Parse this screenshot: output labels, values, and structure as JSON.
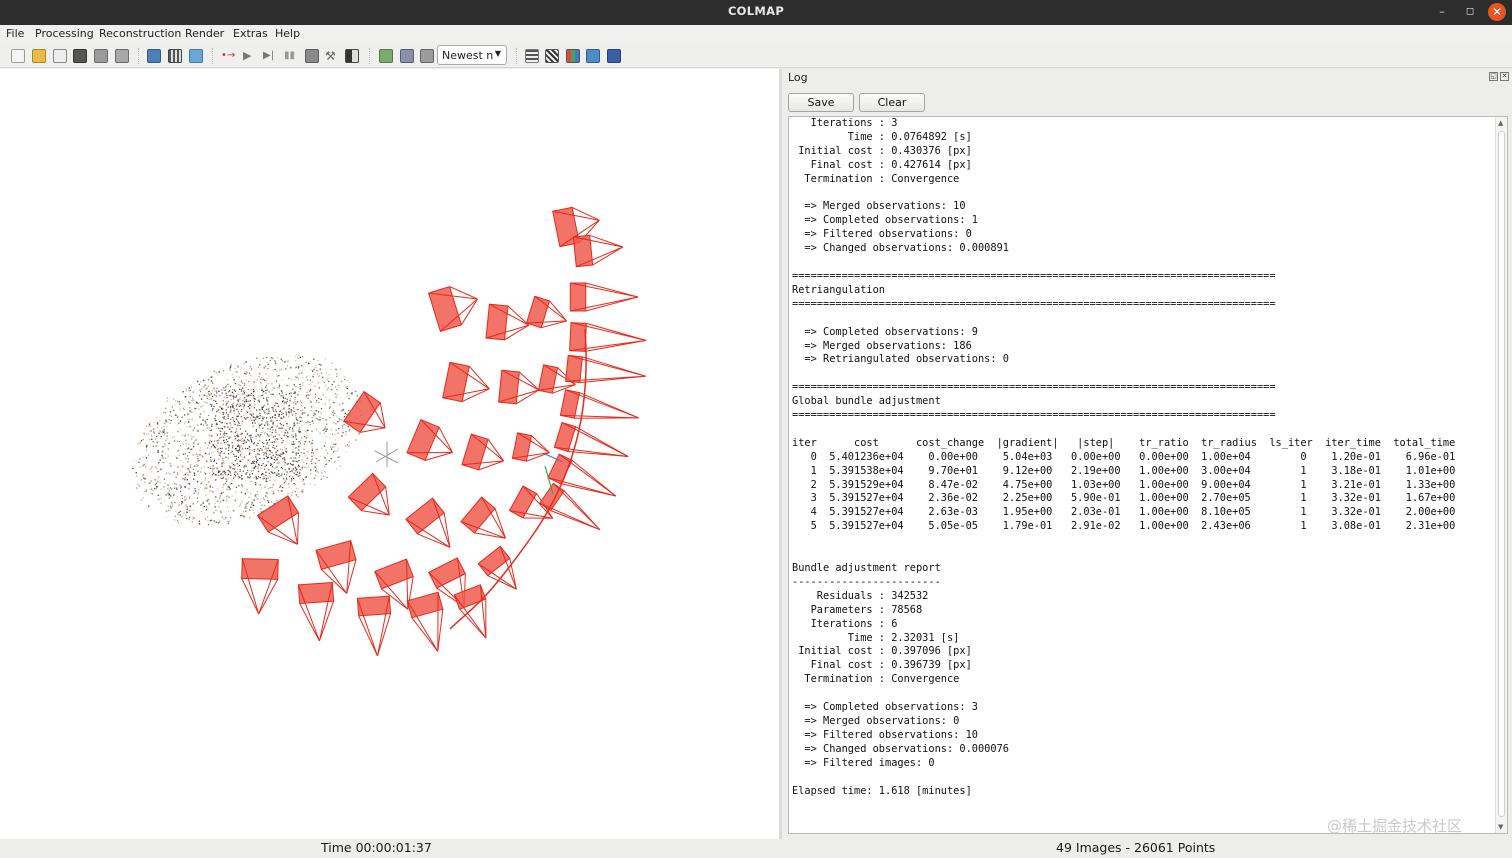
{
  "window": {
    "title": "COLMAP",
    "min_symbol": "–",
    "max_symbol": "◻",
    "close_symbol": "✕"
  },
  "menu": [
    "File",
    "Processing",
    "Reconstruction",
    "Render",
    "Extras",
    "Help"
  ],
  "toolbar": {
    "combo_value": "Newest n",
    "icons": [
      "new-project-icon",
      "open-project-icon",
      "edit-project-icon",
      "save-project-icon",
      "import-icon",
      "export-icon",
      "feature-extraction-icon",
      "feature-matching-icon",
      "database-icon",
      "reconstruction-start-icon",
      "reconstruction-play-icon",
      "reconstruction-step-icon",
      "reconstruction-pause-icon",
      "bundle-adjustment-icon",
      "dense-reconstruction-icon",
      "render-options-icon",
      "grab-image-icon",
      "grab-movie-icon",
      "reset-view-icon",
      "log-icon",
      "match-matrix-icon",
      "model-stats-icon",
      "show-images-icon",
      "show-points-icon"
    ]
  },
  "log": {
    "title": "Log",
    "save_label": "Save",
    "clear_label": "Clear",
    "lines": [
      "   Iterations : 3",
      "         Time : 0.0764892 [s]",
      " Initial cost : 0.430376 [px]",
      "   Final cost : 0.427614 [px]",
      "  Termination : Convergence",
      "",
      "  => Merged observations: 10",
      "  => Completed observations: 1",
      "  => Filtered observations: 0",
      "  => Changed observations: 0.000891",
      "",
      "==============================================================================",
      "Retriangulation",
      "==============================================================================",
      "",
      "  => Completed observations: 9",
      "  => Merged observations: 186",
      "  => Retriangulated observations: 0",
      "",
      "==============================================================================",
      "Global bundle adjustment",
      "==============================================================================",
      "",
      "iter      cost      cost_change  |gradient|   |step|    tr_ratio  tr_radius  ls_iter  iter_time  total_time",
      "   0  5.401236e+04    0.00e+00    5.04e+03   0.00e+00   0.00e+00  1.00e+04        0    1.20e-01    6.96e-01",
      "   1  5.391538e+04    9.70e+01    9.12e+00   2.19e+00   1.00e+00  3.00e+04        1    3.18e-01    1.01e+00",
      "   2  5.391529e+04    8.47e-02    4.75e+00   1.03e+00   1.00e+00  9.00e+04        1    3.21e-01    1.33e+00",
      "   3  5.391527e+04    2.36e-02    2.25e+00   5.90e-01   1.00e+00  2.70e+05        1    3.32e-01    1.67e+00",
      "   4  5.391527e+04    2.63e-03    1.95e+00   2.03e-01   1.00e+00  8.10e+05        1    3.32e-01    2.00e+00",
      "   5  5.391527e+04    5.05e-05    1.79e-01   2.91e-02   1.00e+00  2.43e+06        1    3.08e-01    2.31e+00",
      "",
      "",
      "Bundle adjustment report",
      "------------------------",
      "    Residuals : 342532",
      "   Parameters : 78568",
      "   Iterations : 6",
      "         Time : 2.32031 [s]",
      " Initial cost : 0.397096 [px]",
      "   Final cost : 0.396739 [px]",
      "  Termination : Convergence",
      "",
      "  => Completed observations: 3",
      "  => Merged observations: 0",
      "  => Filtered observations: 10",
      "  => Changed observations: 0.000076",
      "  => Filtered images: 0",
      "",
      "Elapsed time: 1.618 [minutes]"
    ]
  },
  "watermark": "@稀土掘金技术社区",
  "status": {
    "time": "Time 00:00:01:37",
    "counts": "49 Images - 26061 Points"
  },
  "colors": {
    "camera": "#e8291c",
    "camera_fill": "#f05a4c",
    "titlebar": "#2d2d2d",
    "close": "#e95420"
  }
}
